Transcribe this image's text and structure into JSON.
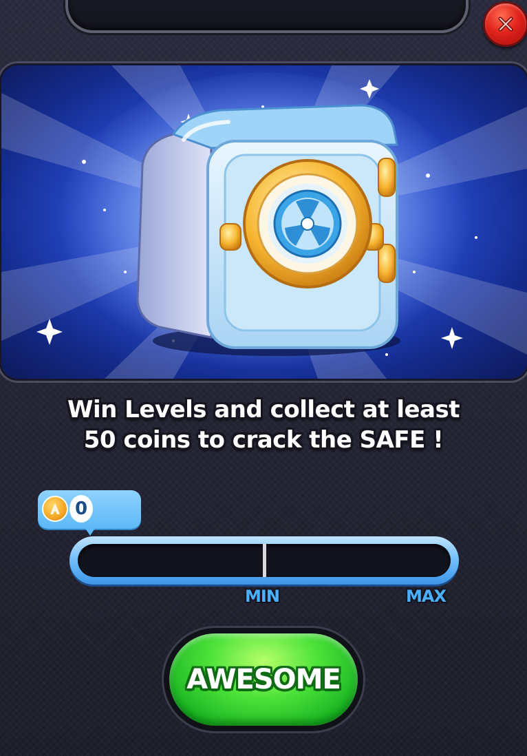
{
  "popup": {
    "instruction_line1": "Win Levels and collect at least",
    "instruction_line2": "50 coins to crack the SAFE !"
  },
  "coin_counter": {
    "value": "0",
    "icon": "coin-icon"
  },
  "progress": {
    "current": 0,
    "min_label": "MIN",
    "max_label": "MAX"
  },
  "buttons": {
    "confirm_label": "AWESOME",
    "close_icon": "close-icon"
  },
  "colors": {
    "accent_blue": "#4ab0ff",
    "button_green": "#34c92c",
    "close_red": "#e0241c"
  }
}
